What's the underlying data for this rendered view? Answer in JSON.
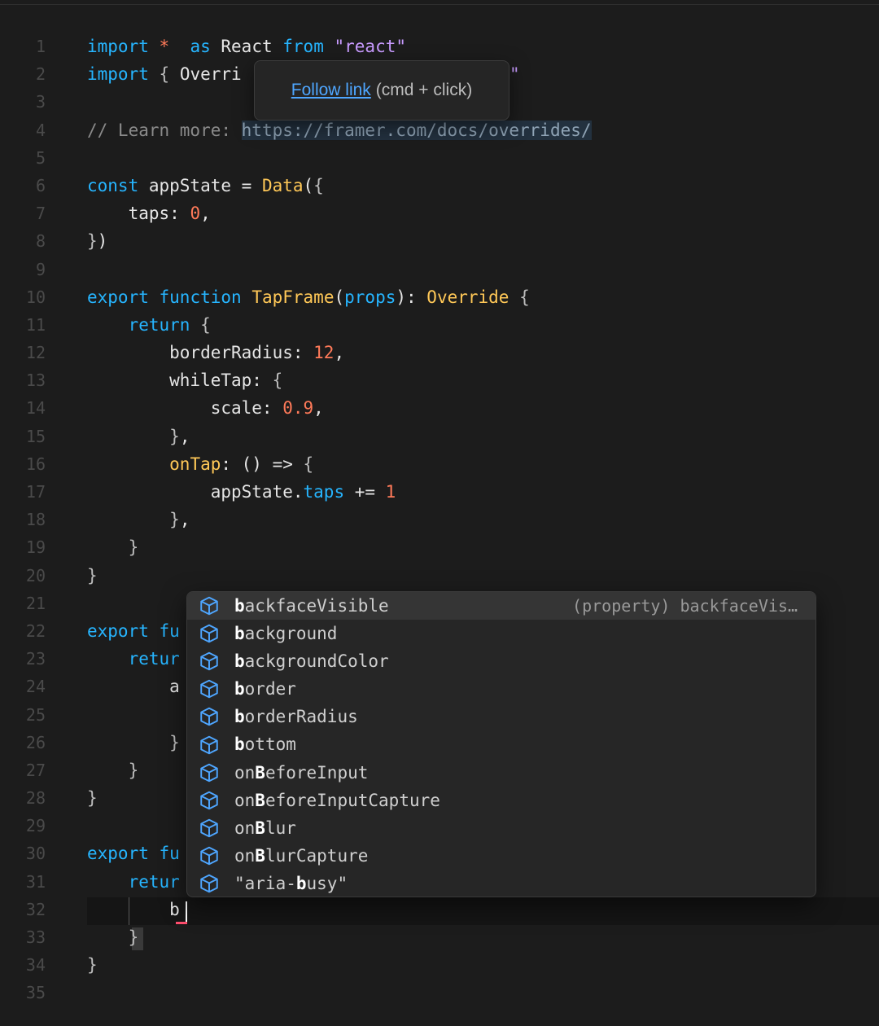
{
  "editor": {
    "lines": [
      {
        "n": "1",
        "t": [
          [
            "kw",
            "import"
          ],
          [
            "num",
            " *"
          ],
          [
            "",
            "  "
          ],
          [
            "kw",
            "as"
          ],
          [
            "",
            " React "
          ],
          [
            "kw",
            "from"
          ],
          [
            "",
            " "
          ],
          [
            "str",
            "\"react\""
          ]
        ]
      },
      {
        "n": "2",
        "t": [
          [
            "kw",
            "import"
          ],
          [
            "",
            " "
          ],
          [
            "brace",
            "{"
          ],
          [
            "",
            " Overri"
          ]
        ],
        "tail": [
          [
            "str",
            "\""
          ]
        ]
      },
      {
        "n": "3",
        "t": []
      },
      {
        "n": "4",
        "t": [
          [
            "cm",
            "// Learn more: "
          ],
          [
            "urlhl",
            "https://framer.com/docs/overrides/"
          ]
        ]
      },
      {
        "n": "5",
        "t": []
      },
      {
        "n": "6",
        "t": [
          [
            "kw",
            "const"
          ],
          [
            "",
            " appState = "
          ],
          [
            "fn",
            "Data"
          ],
          [
            "",
            "("
          ],
          [
            "brace",
            "{"
          ]
        ]
      },
      {
        "n": "7",
        "t": [
          [
            "",
            "    taps: "
          ],
          [
            "num",
            "0"
          ],
          [
            "",
            ","
          ]
        ]
      },
      {
        "n": "8",
        "t": [
          [
            "brace",
            "}"
          ],
          [
            "",
            ")"
          ]
        ]
      },
      {
        "n": "9",
        "t": []
      },
      {
        "n": "10",
        "t": [
          [
            "kw",
            "export"
          ],
          [
            "",
            " "
          ],
          [
            "kw",
            "function"
          ],
          [
            "",
            " "
          ],
          [
            "fn",
            "TapFrame"
          ],
          [
            "",
            "("
          ],
          [
            "prop",
            "props"
          ],
          [
            "",
            "): "
          ],
          [
            "fn",
            "Override"
          ],
          [
            "",
            " "
          ],
          [
            "brace",
            "{"
          ]
        ]
      },
      {
        "n": "11",
        "t": [
          [
            "",
            "    "
          ],
          [
            "kw",
            "return"
          ],
          [
            "",
            " "
          ],
          [
            "brace",
            "{"
          ]
        ]
      },
      {
        "n": "12",
        "t": [
          [
            "",
            "        borderRadius: "
          ],
          [
            "num",
            "12"
          ],
          [
            "",
            ","
          ]
        ]
      },
      {
        "n": "13",
        "t": [
          [
            "",
            "        whileTap: "
          ],
          [
            "brace",
            "{"
          ]
        ]
      },
      {
        "n": "14",
        "t": [
          [
            "",
            "            scale: "
          ],
          [
            "num",
            "0.9"
          ],
          [
            "",
            ","
          ]
        ]
      },
      {
        "n": "15",
        "t": [
          [
            "",
            "        "
          ],
          [
            "brace",
            "}"
          ],
          [
            "",
            ","
          ]
        ]
      },
      {
        "n": "16",
        "t": [
          [
            "",
            "        "
          ],
          [
            "fn",
            "onTap"
          ],
          [
            "",
            ": () => "
          ],
          [
            "brace",
            "{"
          ]
        ]
      },
      {
        "n": "17",
        "t": [
          [
            "",
            "            appState."
          ],
          [
            "prop",
            "taps"
          ],
          [
            "",
            " += "
          ],
          [
            "num",
            "1"
          ]
        ]
      },
      {
        "n": "18",
        "t": [
          [
            "",
            "        "
          ],
          [
            "brace",
            "}"
          ],
          [
            "",
            ","
          ]
        ]
      },
      {
        "n": "19",
        "t": [
          [
            "",
            "    "
          ],
          [
            "brace",
            "}"
          ]
        ]
      },
      {
        "n": "20",
        "t": [
          [
            "brace",
            "}"
          ]
        ]
      },
      {
        "n": "21",
        "t": []
      },
      {
        "n": "22",
        "t": [
          [
            "kw",
            "export"
          ],
          [
            "",
            " "
          ],
          [
            "kw",
            "fu"
          ]
        ]
      },
      {
        "n": "23",
        "t": [
          [
            "",
            "    "
          ],
          [
            "kw",
            "retur"
          ]
        ]
      },
      {
        "n": "24",
        "t": [
          [
            "",
            "        a"
          ]
        ]
      },
      {
        "n": "25",
        "t": []
      },
      {
        "n": "26",
        "t": [
          [
            "",
            "        "
          ],
          [
            "brace",
            "}"
          ]
        ]
      },
      {
        "n": "27",
        "t": [
          [
            "",
            "    "
          ],
          [
            "brace",
            "}"
          ]
        ]
      },
      {
        "n": "28",
        "t": [
          [
            "brace",
            "}"
          ]
        ]
      },
      {
        "n": "29",
        "t": []
      },
      {
        "n": "30",
        "t": [
          [
            "kw",
            "export"
          ],
          [
            "",
            " "
          ],
          [
            "kw",
            "fu"
          ]
        ]
      },
      {
        "n": "31",
        "t": [
          [
            "",
            "    "
          ],
          [
            "kw",
            "retur"
          ]
        ]
      },
      {
        "n": "32",
        "t": [
          [
            "",
            "        b"
          ]
        ]
      },
      {
        "n": "33",
        "t": [
          [
            "",
            "    "
          ],
          [
            "brace",
            "}"
          ]
        ]
      },
      {
        "n": "34",
        "t": [
          [
            "brace",
            "}"
          ]
        ]
      },
      {
        "n": "35",
        "t": []
      }
    ]
  },
  "tooltip": {
    "link_text": "Follow link",
    "hint_text": "(cmd + click)"
  },
  "suggestions": {
    "icon": "cube-icon",
    "accent_color": "#4ea6ff",
    "items": [
      {
        "pre": "",
        "match": "b",
        "rest": "ackfaceVisible",
        "detail": "(property) backfaceVis…",
        "selected": true
      },
      {
        "pre": "",
        "match": "b",
        "rest": "ackground",
        "detail": ""
      },
      {
        "pre": "",
        "match": "b",
        "rest": "ackgroundColor",
        "detail": ""
      },
      {
        "pre": "",
        "match": "b",
        "rest": "order",
        "detail": ""
      },
      {
        "pre": "",
        "match": "b",
        "rest": "orderRadius",
        "detail": ""
      },
      {
        "pre": "",
        "match": "b",
        "rest": "ottom",
        "detail": ""
      },
      {
        "pre": "on",
        "match": "B",
        "rest": "eforeInput",
        "detail": ""
      },
      {
        "pre": "on",
        "match": "B",
        "rest": "eforeInputCapture",
        "detail": ""
      },
      {
        "pre": "on",
        "match": "B",
        "rest": "lur",
        "detail": ""
      },
      {
        "pre": "on",
        "match": "B",
        "rest": "lurCapture",
        "detail": ""
      },
      {
        "pre": "\"aria-",
        "match": "b",
        "rest": "usy\"",
        "detail": ""
      }
    ]
  }
}
